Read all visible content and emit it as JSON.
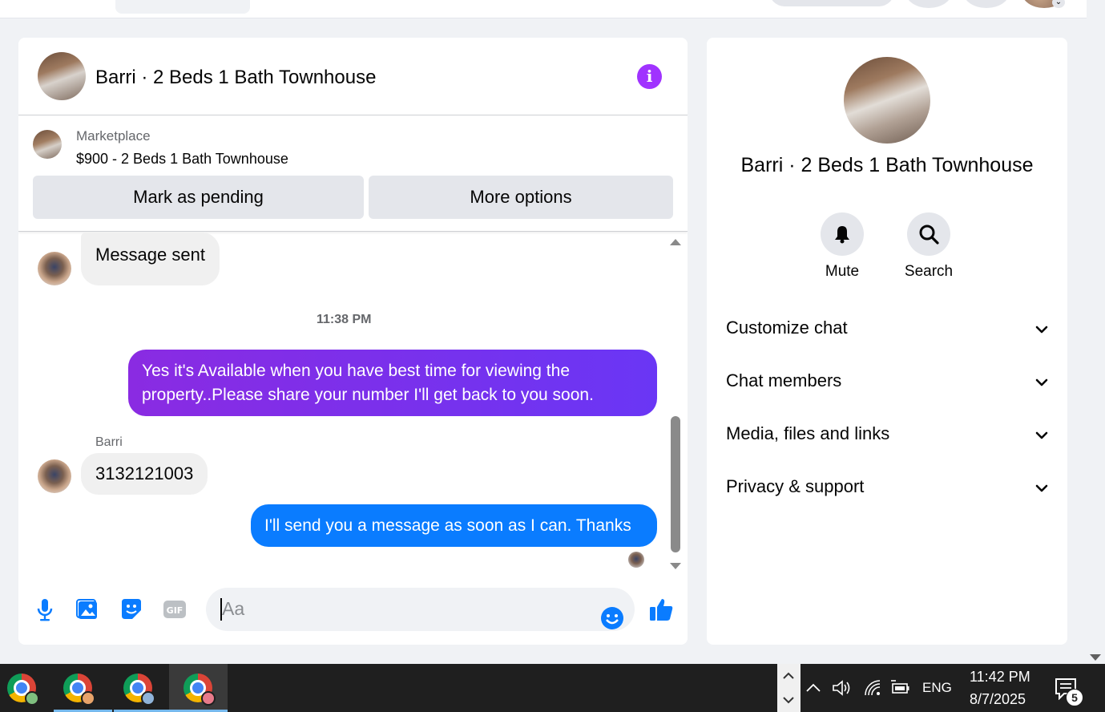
{
  "chat": {
    "title": "Barri · 2 Beds 1 Bath Townhouse",
    "marketplace_label": "Marketplace",
    "listing": "$900 - 2 Beds 1 Bath Townhouse",
    "mark_pending_label": "Mark as pending",
    "more_options_label": "More options"
  },
  "messages": {
    "first_incoming": "Message sent",
    "timestamp": "11:38 PM",
    "outgoing_1": "Yes it's Available when you have best time for viewing the property..Please share your number I'll get back to you soon.",
    "sender_name": "Barri",
    "incoming_2": "3132121003",
    "outgoing_2": "I'll send you a message as soon as I can. Thanks"
  },
  "composer": {
    "placeholder": "Aa"
  },
  "info_panel": {
    "title": "Barri · 2 Beds 1 Bath Townhouse",
    "mute_label": "Mute",
    "search_label": "Search",
    "sections": [
      "Customize chat",
      "Chat members",
      "Media, files and links",
      "Privacy & support"
    ]
  },
  "taskbar": {
    "language": "ENG",
    "time": "11:42 PM",
    "date": "8/7/2025",
    "notification_count": "5"
  },
  "colors": {
    "accent_purple": "#a033ff",
    "bubble_gradient_start": "#8a2be2",
    "bubble_blue": "#0a7cff",
    "like_blue": "#0a7cff"
  }
}
